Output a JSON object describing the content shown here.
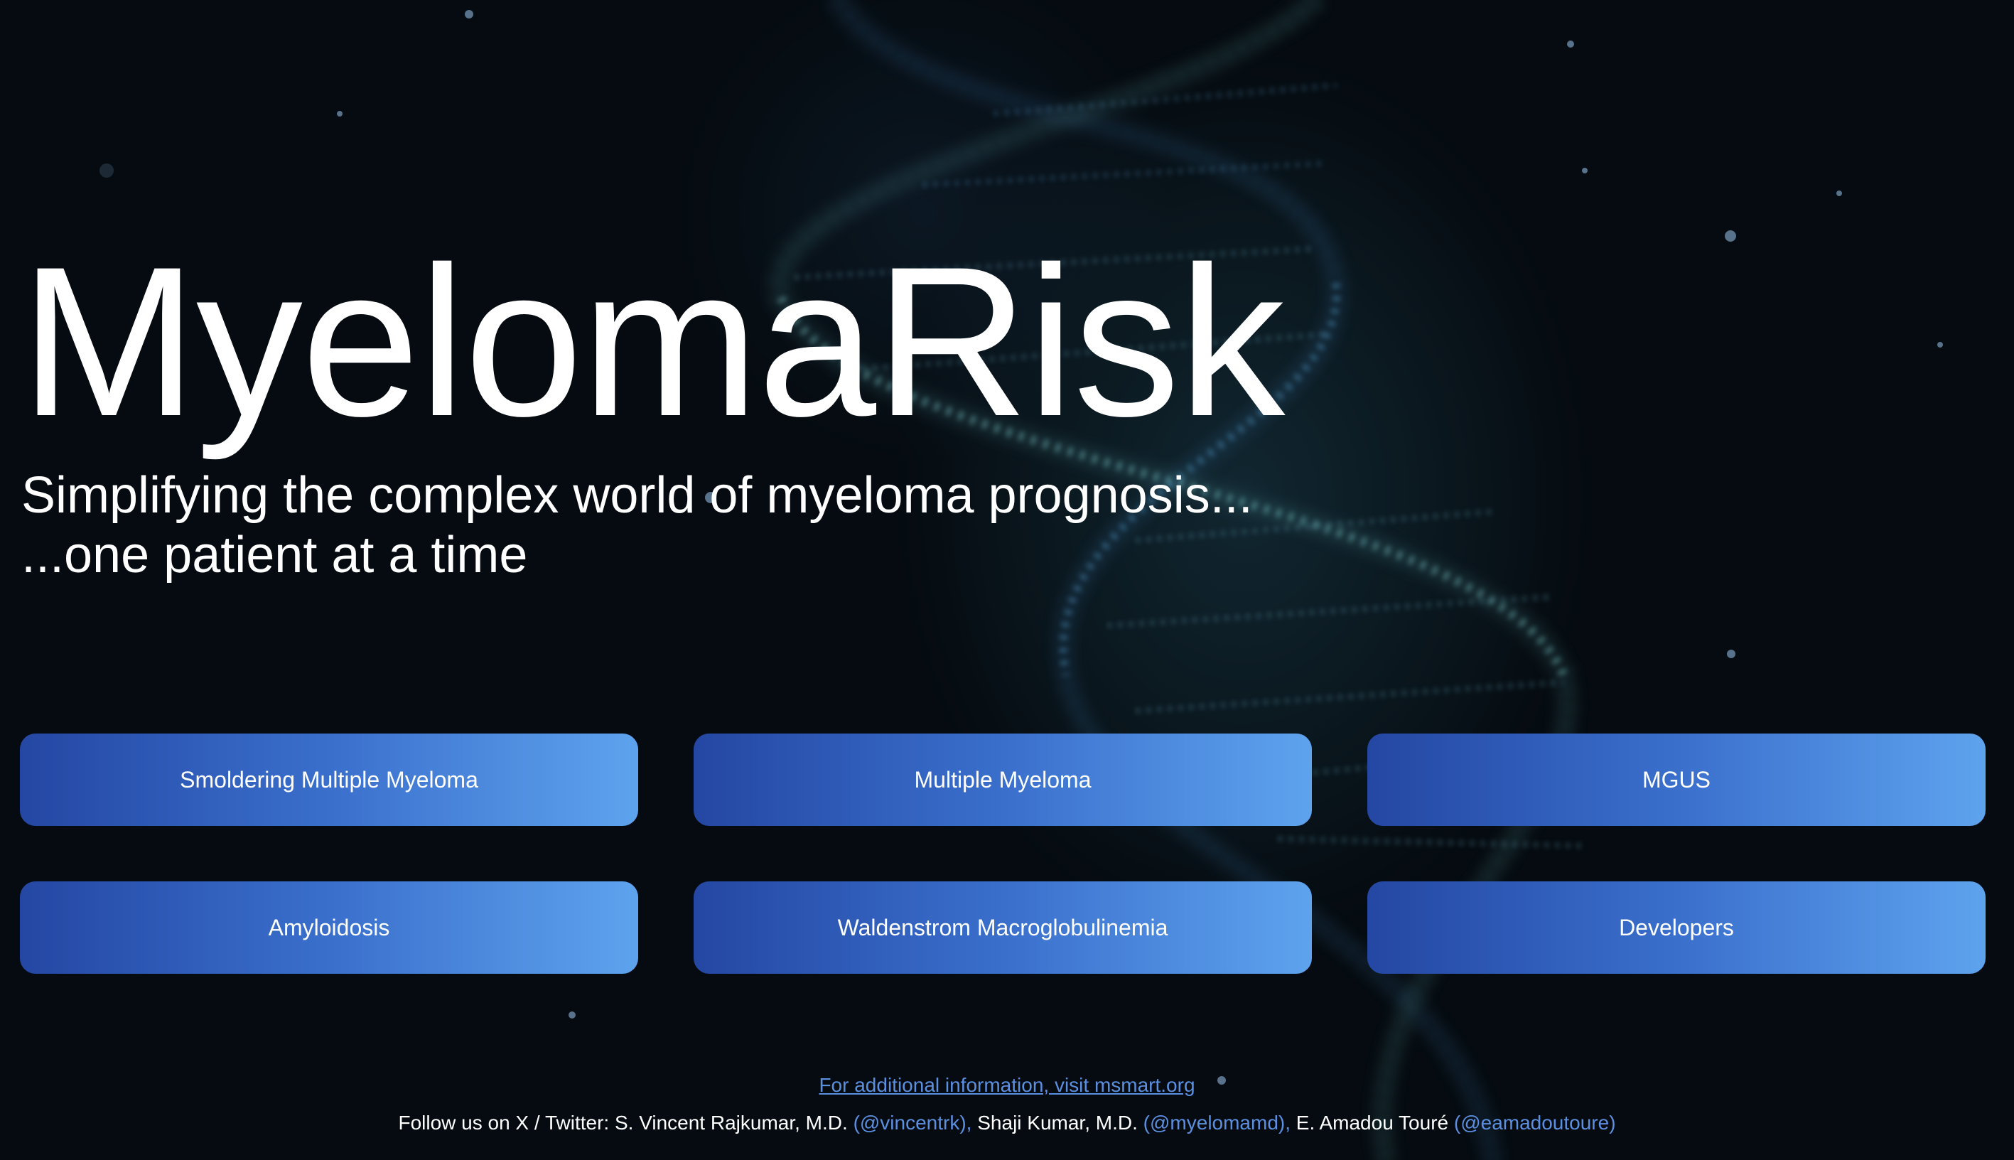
{
  "hero": {
    "title": "MyelomaRisk",
    "subtitle_line1": "Simplifying the complex world of myeloma prognosis...",
    "subtitle_line2": "...one patient at a time"
  },
  "buttons": [
    {
      "label": "Smoldering Multiple Myeloma"
    },
    {
      "label": "Multiple Myeloma"
    },
    {
      "label": "MGUS"
    },
    {
      "label": "Amyloidosis"
    },
    {
      "label": "Waldenstrom Macroglobulinemia"
    },
    {
      "label": "Developers"
    }
  ],
  "footer": {
    "info_link": "For additional information, visit msmart.org",
    "follow_prefix": "Follow us on X / Twitter: S. Vincent Rajkumar, M.D.",
    "handle1": "(@vincentrk),",
    "name2": "Shaji Kumar, M.D.",
    "handle2": "(@myelomamd),",
    "name3": "E. Amadou Touré",
    "handle3": "(@eamadoutoure)"
  },
  "colors": {
    "background": "#050b10",
    "button_gradient_start": "#2447a3",
    "button_gradient_end": "#5ea3ee",
    "link": "#5b8fe0",
    "helix": "#6fc3c8"
  },
  "icons": {
    "background_image": "dna-helix-illustration"
  }
}
